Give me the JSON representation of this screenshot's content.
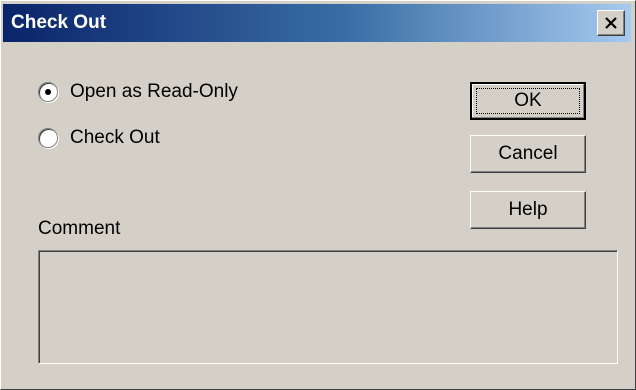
{
  "window": {
    "title": "Check Out",
    "close_symbol": "×"
  },
  "options": [
    {
      "label": "Open as Read-Only",
      "selected": true
    },
    {
      "label": "Check Out",
      "selected": false
    }
  ],
  "buttons": {
    "ok": "OK",
    "cancel": "Cancel",
    "help": "Help"
  },
  "comment": {
    "label": "Comment",
    "value": ""
  },
  "colors": {
    "title_start": "#0a246a",
    "title_end": "#a6caf0",
    "face": "#d4d0c8"
  },
  "icons": [
    "close-icon"
  ]
}
